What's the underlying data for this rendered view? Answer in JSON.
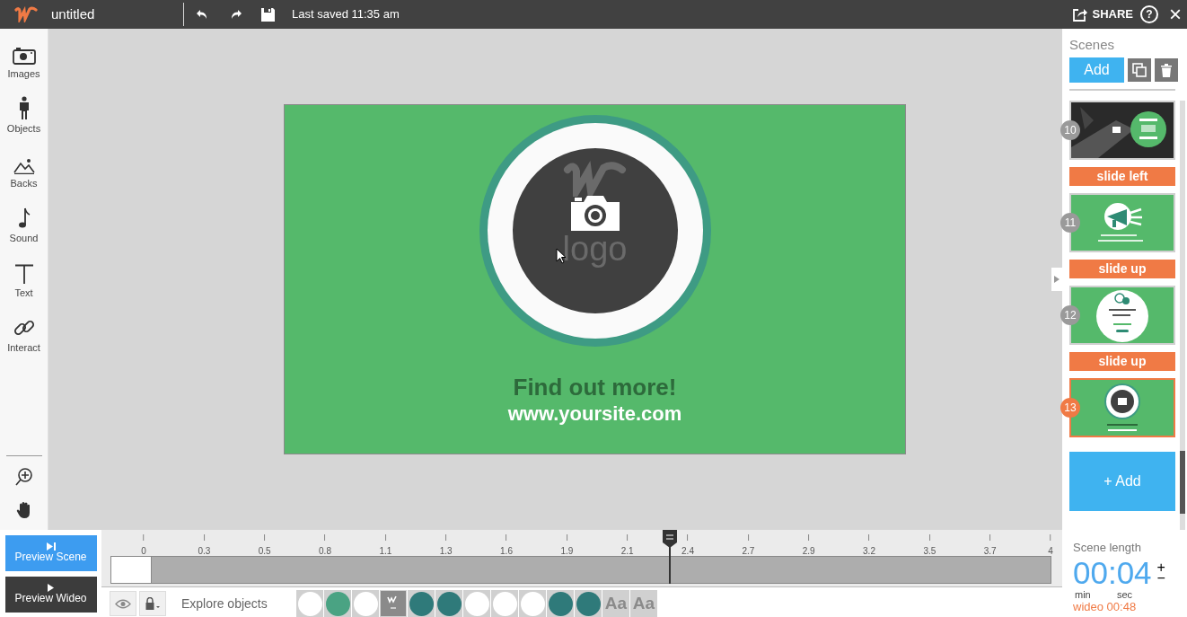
{
  "app": {
    "title": "untitled",
    "last_saved": "Last saved 11:35 am",
    "share": "SHARE",
    "help": "?",
    "close": "×"
  },
  "tools": [
    {
      "kind": "images",
      "label": "Images"
    },
    {
      "kind": "objects",
      "label": "Objects"
    },
    {
      "kind": "backs",
      "label": "Backs"
    },
    {
      "kind": "sound",
      "label": "Sound"
    },
    {
      "kind": "text",
      "label": "Text"
    },
    {
      "kind": "interact",
      "label": "Interact"
    }
  ],
  "stage": {
    "logo_text": "logo",
    "headline": "Find out more!",
    "url": "www.yoursite.com"
  },
  "scenes_panel": {
    "title": "Scenes",
    "add": "Add",
    "add_tile": "+ Add",
    "scenes": [
      {
        "number": "10",
        "kind": "photo",
        "selected": false,
        "transition": "slide left"
      },
      {
        "number": "11",
        "kind": "megaphone",
        "selected": false,
        "transition": "slide up"
      },
      {
        "number": "12",
        "kind": "testimonial",
        "selected": false,
        "transition": "slide up"
      },
      {
        "number": "13",
        "kind": "logo",
        "selected": true
      }
    ]
  },
  "scene_length": {
    "label": "Scene length",
    "time": "00:04",
    "min": "min",
    "sec": "sec",
    "plus": "+",
    "minus": "−",
    "total": "wideo 00:48"
  },
  "preview": {
    "scene": "Preview Scene",
    "video": "Preview Wideo"
  },
  "timeline": {
    "ticks": [
      "0",
      "0.3",
      "0.5",
      "0.8",
      "1.1",
      "1.3",
      "1.6",
      "1.9",
      "2.1",
      "2.4",
      "2.7",
      "2.9",
      "3.2",
      "3.5",
      "3.7",
      "4"
    ],
    "level": 0.595
  },
  "objects_bar": {
    "label": "Explore objects",
    "objects": [
      {
        "kind": "circle",
        "color": "#ffffff"
      },
      {
        "kind": "circle",
        "color": "#4aa383"
      },
      {
        "kind": "circle",
        "color": "#ffffff"
      },
      {
        "kind": "logo"
      },
      {
        "kind": "circle",
        "color": "#2f7a7a"
      },
      {
        "kind": "circle",
        "color": "#2f7a7a"
      },
      {
        "kind": "circle",
        "color": "#ffffff"
      },
      {
        "kind": "circle",
        "color": "#ffffff"
      },
      {
        "kind": "circle",
        "color": "#ffffff"
      },
      {
        "kind": "circle",
        "color": "#2f7a7a"
      },
      {
        "kind": "circle",
        "color": "#2f7a7a"
      },
      {
        "kind": "text",
        "label": "Aa"
      },
      {
        "kind": "text",
        "label": "Aa"
      }
    ]
  }
}
